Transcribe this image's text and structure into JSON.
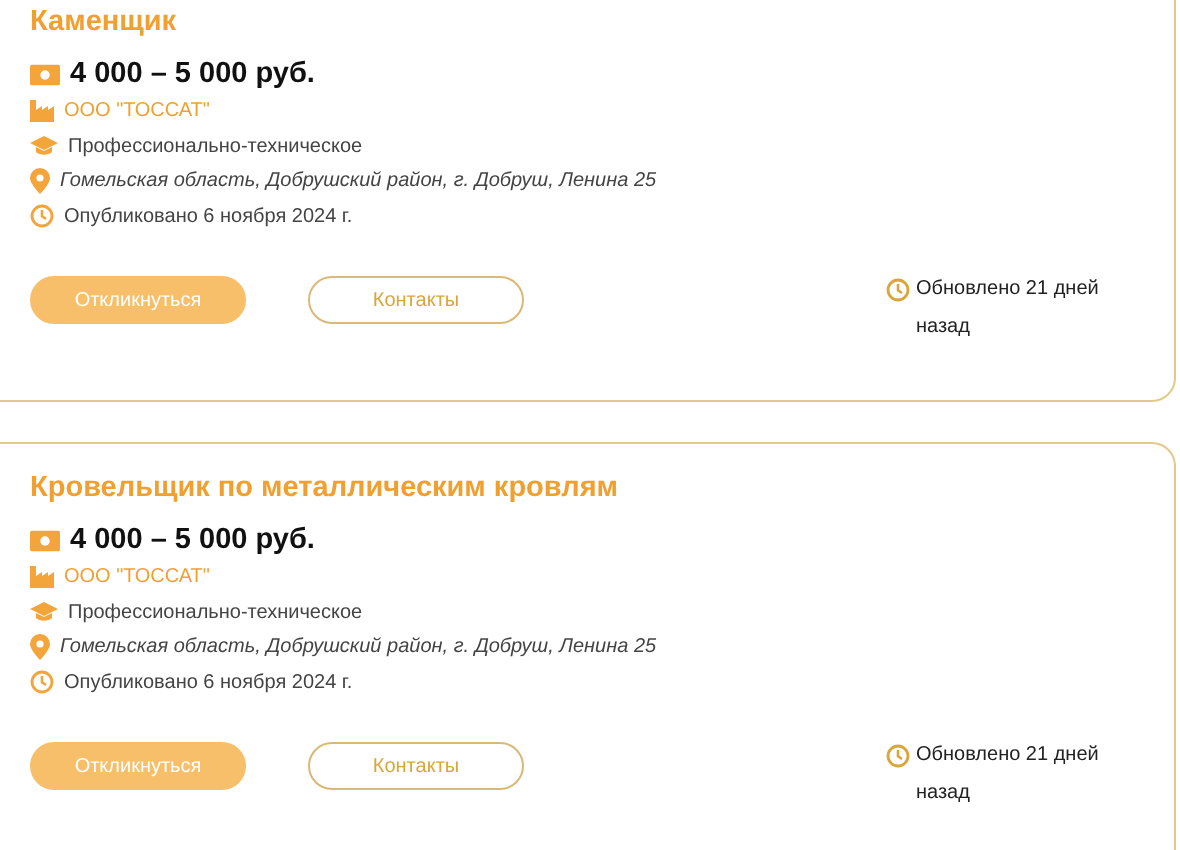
{
  "vacancies": [
    {
      "title": "Каменщик",
      "salary": "4 000 – 5 000 руб.",
      "company": "ООО \"ТОССАТ\"",
      "education": "Профессионально-техническое",
      "address": "Гомельская область, Добрушский район, г. Добруш, Ленина 25",
      "published": "Опубликовано 6 ноября 2024 г.",
      "respond_button": "Откликнуться",
      "contacts_button": "Контакты",
      "updated": "Обновлено 21 дней назад"
    },
    {
      "title": "Кровельщик по металлическим кровлям",
      "salary": "4 000 – 5 000 руб.",
      "company": "ООО \"ТОССАТ\"",
      "education": "Профессионально-техническое",
      "address": "Гомельская область, Добрушский район, г. Добруш, Ленина 25",
      "published": "Опубликовано 6 ноября 2024 г.",
      "respond_button": "Откликнуться",
      "contacts_button": "Контакты",
      "updated": "Обновлено 21 дней назад"
    }
  ]
}
